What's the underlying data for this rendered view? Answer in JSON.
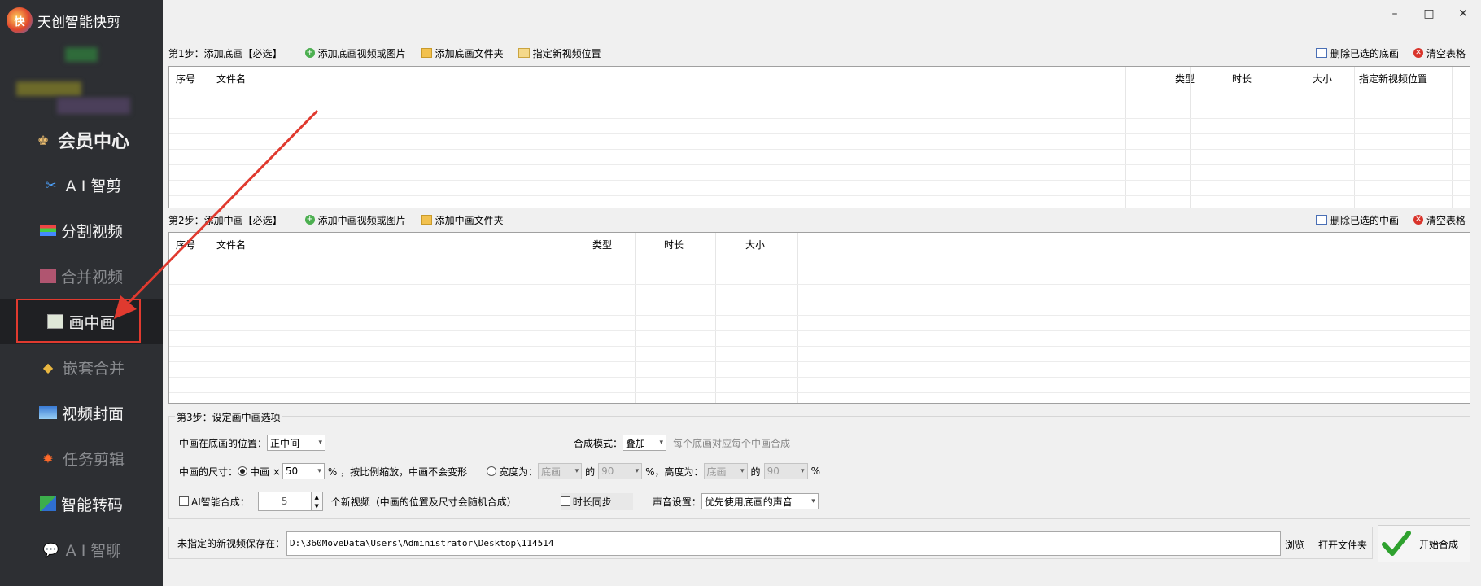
{
  "app": {
    "title": "天创智能快剪",
    "logo_text": "快"
  },
  "window": {
    "minimize": "–",
    "maximize": "□",
    "close": "✕"
  },
  "sidebar": {
    "items": [
      {
        "label": "会员中心",
        "icon": "vip-user-icon"
      },
      {
        "label": "A I 智剪",
        "icon": "ai-cut-icon"
      },
      {
        "label": "分割视频",
        "icon": "split-video-icon"
      },
      {
        "label": "合并视频",
        "icon": "merge-video-icon"
      },
      {
        "label": "画中画",
        "icon": "picture-in-picture-icon"
      },
      {
        "label": "嵌套合并",
        "icon": "nest-merge-icon"
      },
      {
        "label": "视频封面",
        "icon": "video-cover-icon"
      },
      {
        "label": "任务剪辑",
        "icon": "task-edit-icon"
      },
      {
        "label": "智能转码",
        "icon": "transcode-icon"
      },
      {
        "label": "A I 智聊",
        "icon": "ai-chat-icon"
      }
    ],
    "accent": "#e03a2f"
  },
  "step1": {
    "title": "第1步：添加底画【必选】",
    "add_media": "添加底画视频或图片",
    "add_folder": "添加底画文件夹",
    "set_position": "指定新视频位置",
    "delete_selected": "删除已选的底画",
    "clear_table": "清空表格",
    "columns": [
      "序号",
      "文件名",
      "类型",
      "时长",
      "大小",
      "指定新视频位置"
    ]
  },
  "step2": {
    "title": "第2步：添加中画【必选】",
    "add_media": "添加中画视频或图片",
    "add_folder": "添加中画文件夹",
    "delete_selected": "删除已选的中画",
    "clear_table": "清空表格",
    "columns": [
      "序号",
      "文件名",
      "类型",
      "时长",
      "大小"
    ]
  },
  "step3": {
    "title": "第3步：设定画中画选项",
    "position_label": "中画在底画的位置：",
    "position_value": "正中间",
    "mode_label": "合成模式：",
    "mode_value": "叠加",
    "mode_hint": "每个底画对应每个中画合成",
    "size_label": "中画的尺寸：",
    "scale_label": "中画 ×",
    "scale_value": "50",
    "scale_suffix": "% ，按比例缩放，中画不会变形",
    "wh_label": "宽度为：",
    "width_ref": "底画",
    "of1": "的",
    "width_pct": "90",
    "height_label": "%，高度为：",
    "height_ref": "底画",
    "of2": "的",
    "height_pct": "90",
    "pct": "%",
    "ai_label": "AI智能合成：",
    "ai_value": "5",
    "ai_suffix": "个新视频（中画的位置及尺寸会随机合成）",
    "sync_label": "时长同步",
    "audio_label": "声音设置：",
    "audio_value": "优先使用底画的声音"
  },
  "output": {
    "label": "未指定的新视频保存在：",
    "path": "D:\\360MoveData\\Users\\Administrator\\Desktop\\114514",
    "browse": "浏览",
    "open_folder": "打开文件夹",
    "start": "开始合成"
  }
}
